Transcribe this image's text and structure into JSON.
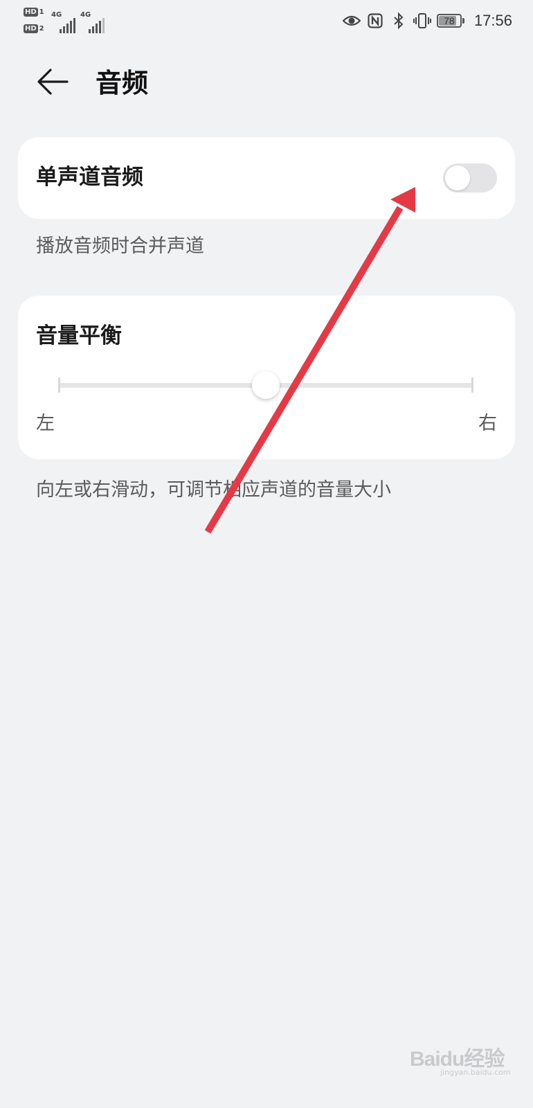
{
  "status_bar": {
    "sim1_badge": "HD",
    "sim1_index": "1",
    "sim2_badge": "HD",
    "sim2_index": "2",
    "sim1_network": "4G",
    "sim2_network": "4G",
    "battery_level": "78",
    "time": "17:56",
    "icons": [
      "eye-comfort-icon",
      "nfc-icon",
      "bluetooth-icon",
      "vibrate-icon",
      "battery-icon"
    ]
  },
  "header": {
    "back_icon": "arrow-left-icon",
    "title": "音频"
  },
  "mono_audio": {
    "label": "单声道音频",
    "enabled": false,
    "description": "播放音频时合并声道"
  },
  "balance": {
    "label": "音量平衡",
    "left_label": "左",
    "right_label": "右",
    "value_fraction": 0.5,
    "description": "向左或右滑动，可调节相应声道的音量大小"
  },
  "annotation": {
    "type": "red-arrow",
    "color": "#e63946",
    "points_to": "mono-audio-toggle"
  },
  "watermark": {
    "logo_text": "Baidu经验",
    "url_text": "jingyan.baidu.com"
  },
  "colors": {
    "background": "#f1f2f4",
    "card": "#ffffff",
    "toggle_off": "#e4e4e6",
    "secondary_text": "#5b5b5b"
  }
}
